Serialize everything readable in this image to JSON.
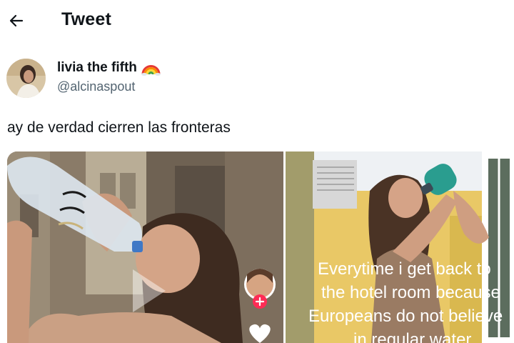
{
  "header": {
    "title": "Tweet",
    "back_icon": "arrow-left-icon"
  },
  "tweet": {
    "author": {
      "display_name": "livia the fifth",
      "emoji": "rainbow-emoji",
      "handle": "@alcinaspout"
    },
    "text": "ay de verdad cierren las fronteras",
    "media": [
      {
        "kind": "video-thumbnail",
        "icons": [
          "play-icon",
          "creator-avatar",
          "follow-plus-icon",
          "heart-icon"
        ]
      },
      {
        "kind": "image",
        "overlay_lines": [
          "Everytime i get back to",
          "the hotel room because",
          "Europeans do not believe",
          "in regular water"
        ]
      }
    ]
  },
  "colors": {
    "text_primary": "#0f1419",
    "text_secondary": "#536471",
    "follow_pink": "#fe2c55"
  }
}
